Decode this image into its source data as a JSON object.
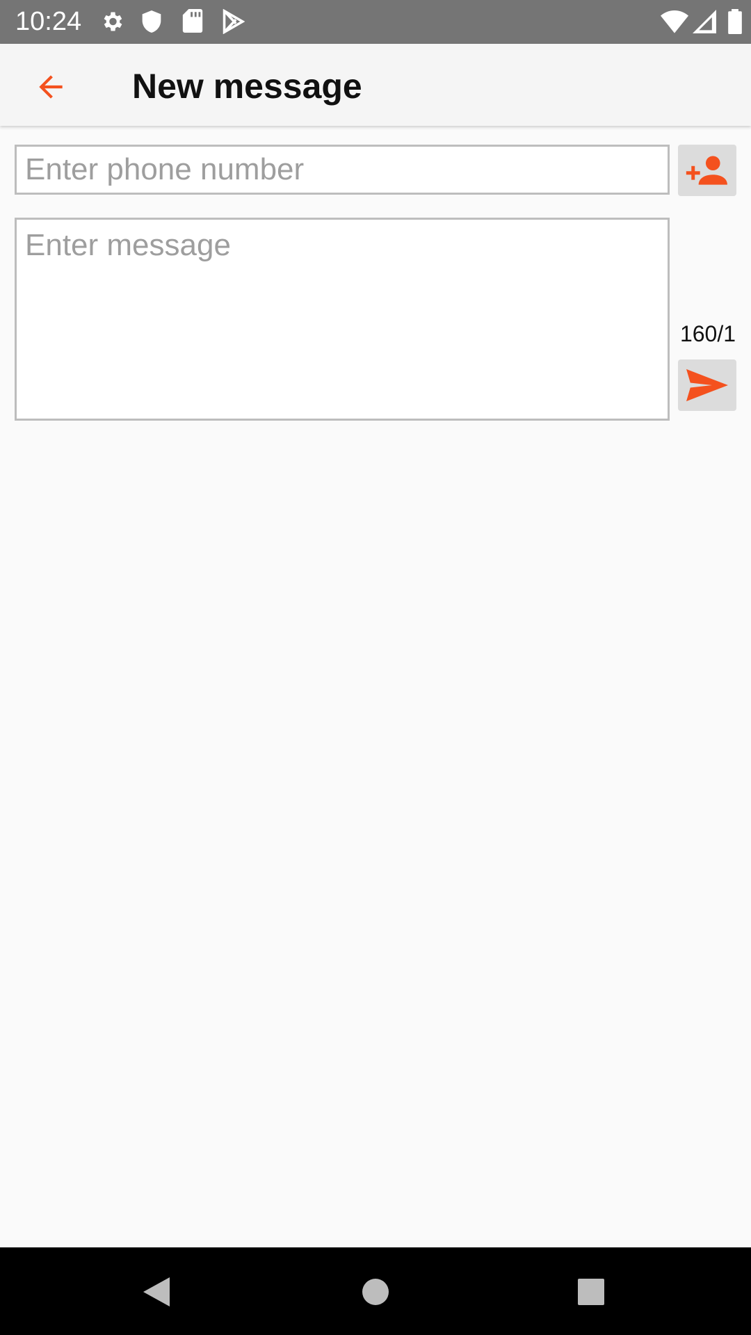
{
  "status_bar": {
    "time": "10:24",
    "icons": [
      "gear-icon",
      "shield-icon",
      "sd-card-icon",
      "play-store-icon",
      "wifi-icon",
      "signal-icon",
      "battery-icon"
    ]
  },
  "app_bar": {
    "title": "New message",
    "back_icon": "arrow-back-icon"
  },
  "compose": {
    "phone_placeholder": "Enter phone number",
    "phone_value": "",
    "message_placeholder": "Enter message",
    "message_value": "",
    "char_counter": "160/1",
    "add_contact_icon": "person-add-icon",
    "send_icon": "send-icon"
  },
  "nav_bar": {
    "icons": [
      "back-triangle-icon",
      "home-circle-icon",
      "recents-square-icon"
    ]
  },
  "colors": {
    "accent": "#f4511e",
    "status_bar": "#757575",
    "app_bar": "#f5f5f5",
    "background": "#fafafa",
    "side_button": "#dcdcdc",
    "nav_bar": "#000000"
  }
}
